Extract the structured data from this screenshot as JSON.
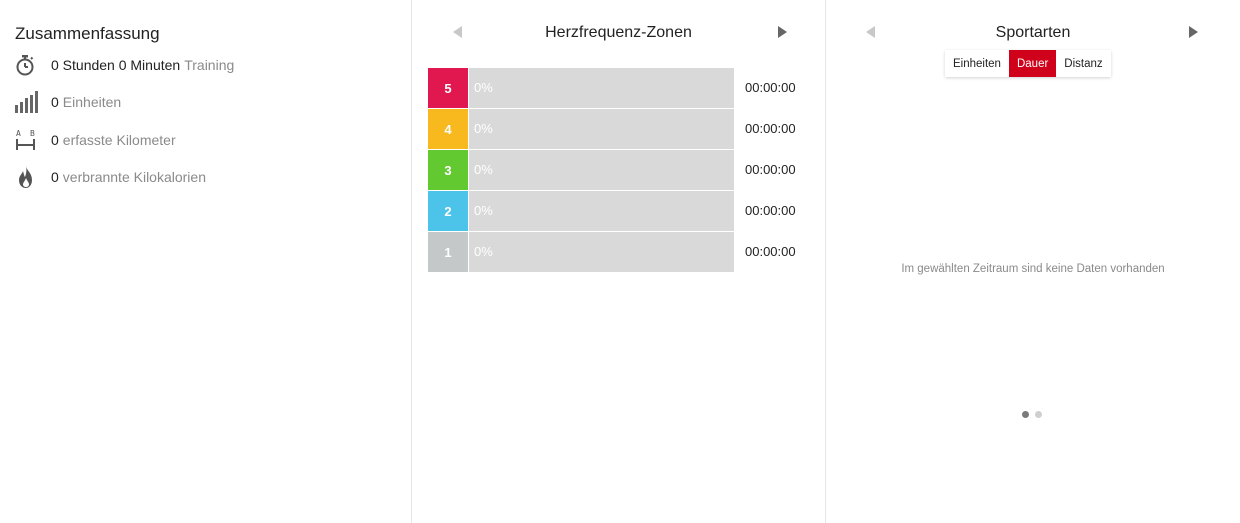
{
  "summary": {
    "title": "Zusammenfassung",
    "rows": [
      {
        "icon": "stopwatch-icon",
        "value": "0 Stunden 0 Minuten",
        "label": "Training"
      },
      {
        "icon": "bar-chart-icon",
        "value": "0",
        "label": "Einheiten"
      },
      {
        "icon": "distance-icon",
        "value": "0",
        "label": "erfasste Kilometer",
        "icon_text_a": "A",
        "icon_text_b": "B"
      },
      {
        "icon": "flame-icon",
        "value": "0",
        "label": "verbrannte Kilokalorien"
      }
    ]
  },
  "heart_rate": {
    "title": "Herzfrequenz-Zonen",
    "zones": [
      {
        "zone": "5",
        "percent_label": "0%",
        "percent": 0,
        "time": "00:00:00",
        "color": "#e0184f"
      },
      {
        "zone": "4",
        "percent_label": "0%",
        "percent": 0,
        "time": "00:00:00",
        "color": "#f7b91e"
      },
      {
        "zone": "3",
        "percent_label": "0%",
        "percent": 0,
        "time": "00:00:00",
        "color": "#62c930"
      },
      {
        "zone": "2",
        "percent_label": "0%",
        "percent": 0,
        "time": "00:00:00",
        "color": "#4cc4ea"
      },
      {
        "zone": "1",
        "percent_label": "0%",
        "percent": 0,
        "time": "00:00:00",
        "color": "#c4c8c8"
      }
    ]
  },
  "sports": {
    "title": "Sportarten",
    "toggle": [
      {
        "label": "Einheiten",
        "active": false
      },
      {
        "label": "Dauer",
        "active": true
      },
      {
        "label": "Distanz",
        "active": false
      }
    ],
    "empty_message": "Im gewählten Zeitraum sind keine Daten vorhanden",
    "pager": {
      "pages": 2,
      "current": 1
    }
  },
  "colors": {
    "accent": "#d0021b",
    "muted_text": "#8a8a8a",
    "bar_background": "#d9d9d9"
  }
}
